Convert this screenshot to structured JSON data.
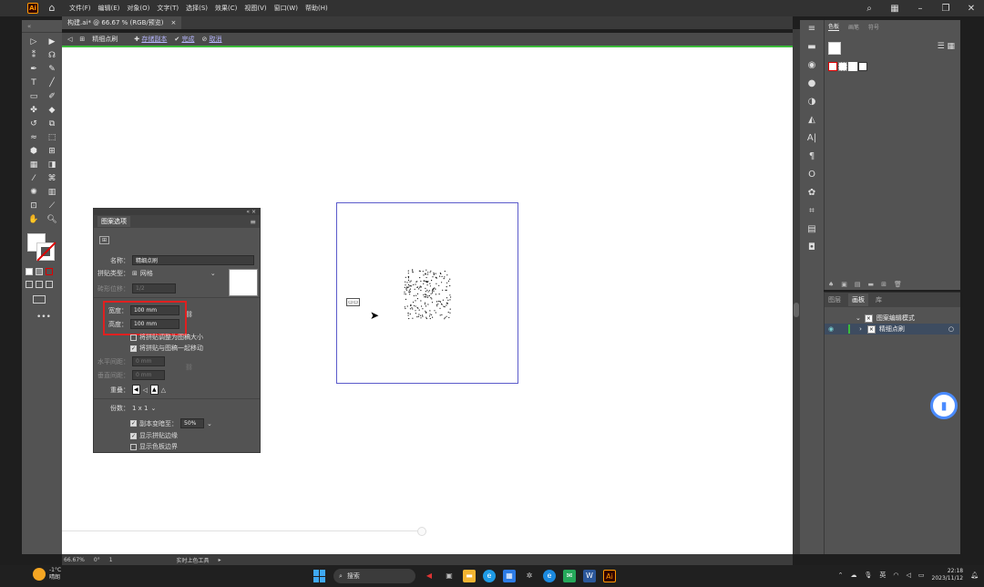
{
  "app": {
    "logo": "Ai",
    "menu": [
      "文件(F)",
      "编辑(E)",
      "对象(O)",
      "文字(T)",
      "选择(S)",
      "效果(C)",
      "视图(V)",
      "窗口(W)",
      "帮助(H)"
    ]
  },
  "document": {
    "tab_title": "构建.ai* @ 66.67 % (RGB/预览)",
    "tab_close": "×"
  },
  "control_bar": {
    "mode_label": "精细点刷",
    "save_copy": "存储副本",
    "done": "完成",
    "cancel": "取消"
  },
  "pattern_options": {
    "panel_title": "图案选项",
    "name_label": "名称：",
    "name_value": "精细点刷",
    "tile_type_label": "拼贴类型：",
    "tile_type_value": "网格",
    "brick_offset_label": "砖形位移：",
    "brick_offset_value": "1/2",
    "width_label": "宽度：",
    "width_value": "100 mm",
    "height_label": "高度：",
    "height_value": "100 mm",
    "size_tile_to_art": "将拼贴调整为图稿大小",
    "move_tile_with_art": "将拼贴与图稿一起移动",
    "h_spacing_label": "水平间距：",
    "h_spacing_value": "0 mm",
    "v_spacing_label": "垂直间距：",
    "v_spacing_value": "0 mm",
    "overlap_label": "重叠：",
    "copies_label": "份数：",
    "copies_value": "1 x 1",
    "dim_copies_label": "副本变暗至：",
    "dim_copies_value": "50%",
    "show_tile_edge": "显示拼贴边缘",
    "show_swatch_bounds": "显示色板边界"
  },
  "swatches_panel": {
    "tabs": [
      "色板",
      "画笔",
      "符号"
    ]
  },
  "layers_panel": {
    "tabs": [
      "图层",
      "画板",
      "库"
    ],
    "rows": [
      {
        "name": "图案编辑模式"
      },
      {
        "name": "精细点刷"
      }
    ]
  },
  "statusbar": {
    "zoom": "66.67%",
    "rotation": "0°",
    "artboard_num": "1",
    "tool_name": "实时上色工具"
  },
  "taskbar": {
    "weather_temp": "-1°C",
    "weather_desc": "晴朗",
    "search": "搜索",
    "ime": "英",
    "time": "22:18",
    "date": "2023/11/12"
  },
  "colors": {
    "accent_green": "#3bbb3b",
    "highlight_red": "#e02020",
    "artboard_border": "#5b5bcb",
    "panel_bg": "#535353"
  }
}
